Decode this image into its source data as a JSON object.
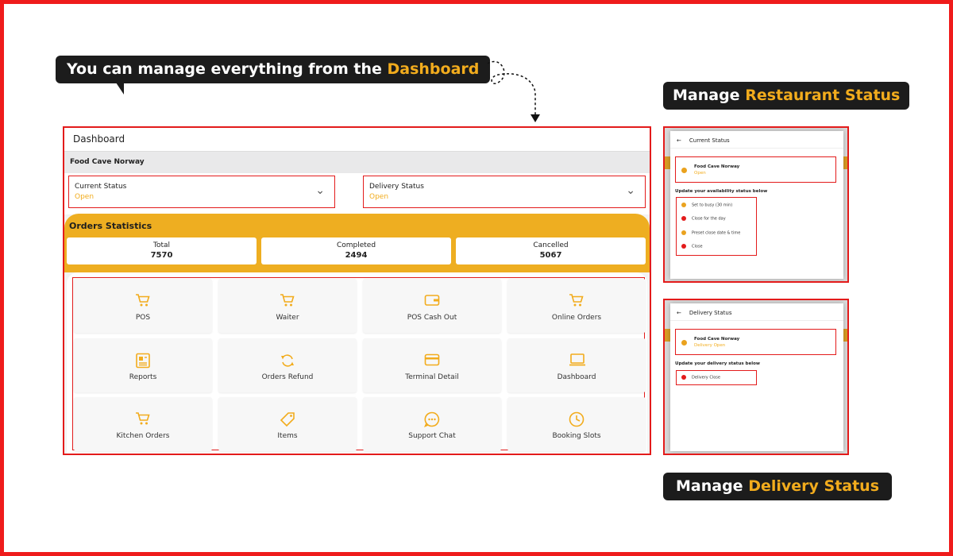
{
  "callouts": {
    "main_prefix": "You can manage everything from the ",
    "main_highlight": "Dashboard",
    "restaurant_prefix": "Manage ",
    "restaurant_highlight": "Restaurant Status",
    "delivery_prefix": "Manage ",
    "delivery_highlight": "Delivery Status"
  },
  "dashboard": {
    "title": "Dashboard",
    "restaurant_name": "Food Cave Norway",
    "current_status": {
      "label": "Current Status",
      "value": "Open"
    },
    "delivery_status": {
      "label": "Delivery Status",
      "value": "Open"
    },
    "stats_title": "Orders Statistics",
    "stats": [
      {
        "label": "Total",
        "value": "7570"
      },
      {
        "label": "Completed",
        "value": "2494"
      },
      {
        "label": "Cancelled",
        "value": "5067"
      }
    ],
    "tiles": [
      {
        "label": "POS",
        "icon": "cart-icon"
      },
      {
        "label": "Waiter",
        "icon": "cart-icon"
      },
      {
        "label": "POS Cash Out",
        "icon": "wallet-icon"
      },
      {
        "label": "Online Orders",
        "icon": "cart-icon"
      },
      {
        "label": "Reports",
        "icon": "report-icon"
      },
      {
        "label": "Orders Refund",
        "icon": "refresh-icon"
      },
      {
        "label": "Terminal Detail",
        "icon": "card-icon"
      },
      {
        "label": "Dashboard",
        "icon": "laptop-icon"
      },
      {
        "label": "Kitchen Orders",
        "icon": "cart-icon"
      },
      {
        "label": "Items",
        "icon": "tag-icon"
      },
      {
        "label": "Support Chat",
        "icon": "chat-icon"
      },
      {
        "label": "Booking Slots",
        "icon": "clock-icon"
      }
    ]
  },
  "restaurant_status_panel": {
    "title": "Current Status",
    "name": "Food Cave Norway",
    "status": "Open",
    "heading": "Update your availability status below",
    "options": [
      {
        "label": "Set to busy (30 min)",
        "color": "#eaa21e"
      },
      {
        "label": "Close for the day",
        "color": "#e31b1b"
      },
      {
        "label": "Preset close date & time",
        "color": "#eaa21e"
      },
      {
        "label": "Close",
        "color": "#e31b1b"
      }
    ]
  },
  "delivery_status_panel": {
    "title": "Delivery Status",
    "name": "Food Cave Norway",
    "status": "Delivery Open",
    "heading": "Update your delivery status below",
    "options": [
      {
        "label": "Delivery Close",
        "color": "#e31b1b"
      }
    ]
  },
  "colors": {
    "accent": "#f2ac1d",
    "highlight_border": "#e31b1b",
    "callout_bg": "#1c1c1c"
  }
}
